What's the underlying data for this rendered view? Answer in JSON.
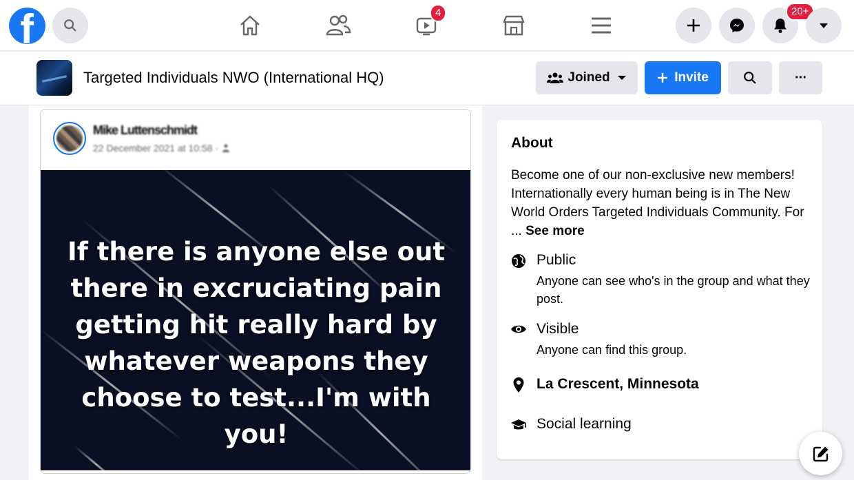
{
  "topbar": {
    "logo_letter": "f",
    "watch_badge": "4",
    "notifications_badge": "20+"
  },
  "group": {
    "name": "Targeted Individuals NWO (International HQ)",
    "joined_label": "Joined",
    "invite_label": "Invite",
    "more_label": "···"
  },
  "post": {
    "author": "Mike Luttenschmidt",
    "meta": "22 December 2021 at 10:58 · ",
    "image_text": "If there is anyone else out there in excruciating pain getting hit really hard by whatever weapons they choose to test...I'm with you!"
  },
  "about": {
    "title": "About",
    "description": "Become one of our non-exclusive new members! Internationally every human being is in The New World Orders Targeted Individuals Community. For ... ",
    "see_more": "See more",
    "privacy_title": "Public",
    "privacy_desc": "Anyone can see who's in the group and what they post.",
    "visibility_title": "Visible",
    "visibility_desc": "Anyone can find this group.",
    "location": "La Crescent, Minnesota",
    "type": "Social learning"
  },
  "icons": [
    "facebook-logo",
    "search-icon",
    "home-icon",
    "friends-icon",
    "watch-icon",
    "marketplace-icon",
    "menu-icon",
    "plus-icon",
    "messenger-icon",
    "bell-icon",
    "chevron-down-icon",
    "globe-icon",
    "eye-icon",
    "location-pin-icon",
    "graduation-cap-icon",
    "compose-icon"
  ],
  "colors": {
    "brand_blue": "#1877f2",
    "badge_red": "#e41e3f",
    "button_gray": "#e4e6eb",
    "post_image_bg": "#0a0f24"
  }
}
